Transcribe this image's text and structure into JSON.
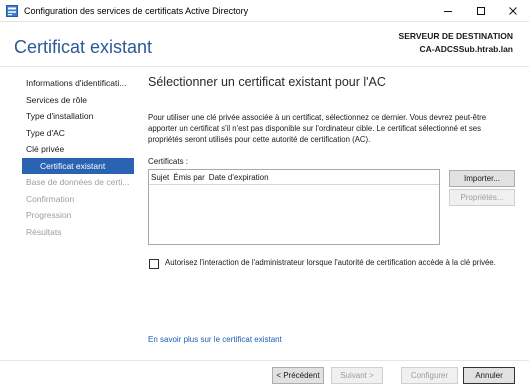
{
  "window": {
    "title": "Configuration des services de certificats Active Directory",
    "minimize_glyph": "—",
    "maximize_glyph": "☐",
    "close_glyph": "✕"
  },
  "header": {
    "title": "Certificat existant",
    "destination_label": "SERVEUR DE DESTINATION",
    "destination_server": "CA-ADCSSub.htrab.lan"
  },
  "sidebar": {
    "items": [
      {
        "label": "Informations d'identificati...",
        "state": "normal"
      },
      {
        "label": "Services de rôle",
        "state": "normal"
      },
      {
        "label": "Type d'installation",
        "state": "normal"
      },
      {
        "label": "Type d'AC",
        "state": "normal"
      },
      {
        "label": "Clé privée",
        "state": "normal"
      },
      {
        "label": "Certificat existant",
        "state": "active"
      },
      {
        "label": "Base de données de certi...",
        "state": "disabled"
      },
      {
        "label": "Confirmation",
        "state": "disabled"
      },
      {
        "label": "Progression",
        "state": "disabled"
      },
      {
        "label": "Résultats",
        "state": "disabled"
      }
    ]
  },
  "main": {
    "heading": "Sélectionner un certificat existant pour l'AC",
    "description": "Pour utiliser une clé privée associée à un certificat, sélectionnez ce dernier. Vous devrez peut-être apporter un certificat s'il n'est pas disponible sur l'ordinateur cible. Le certificat sélectionné et ses propriétés seront utilisés pour cette autorité de certification (AC).",
    "certificates_label": "Certificats :",
    "columns": [
      "Sujet",
      "Émis par",
      "Date d'expiration"
    ],
    "import_button": "Importer...",
    "properties_button": "Propriétés...",
    "allow_interaction_label": "Autorisez l'interaction de l'administrateur lorsque l'autorité de certification accède à la clé privée.",
    "allow_interaction_checked": false,
    "learn_more_link": "En savoir plus sur le certificat existant"
  },
  "footer": {
    "previous_button": "< Précédent",
    "next_button": "Suivant >",
    "configure_button": "Configurer",
    "cancel_button": "Annuler"
  },
  "colors": {
    "accent": "#2b63b3",
    "title_blue": "#2a5a98",
    "link": "#1a5fb4"
  }
}
